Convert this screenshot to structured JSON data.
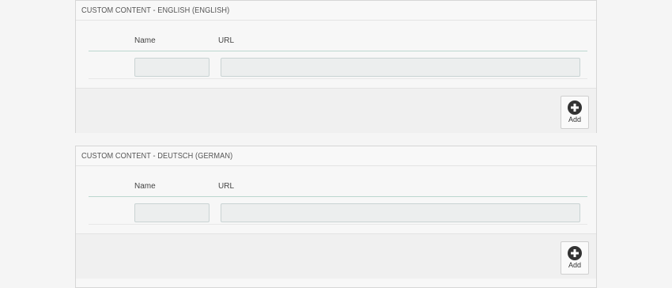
{
  "panels": [
    {
      "title": "CUSTOM CONTENT - ENGLISH (ENGLISH)",
      "columns": {
        "name": "Name",
        "url": "URL"
      },
      "row": {
        "name_value": "",
        "url_value": ""
      },
      "add_label": "Add",
      "add_icon": "plus-circle-icon"
    },
    {
      "title": "CUSTOM CONTENT - DEUTSCH (GERMAN)",
      "columns": {
        "name": "Name",
        "url": "URL"
      },
      "row": {
        "name_value": "",
        "url_value": ""
      },
      "add_label": "Add",
      "add_icon": "plus-circle-icon"
    }
  ],
  "colors": {
    "page_bg": "#f5f5f5",
    "header_line": "#bcd7cf",
    "input_bg": "#eceeee",
    "icon": "#333333"
  }
}
